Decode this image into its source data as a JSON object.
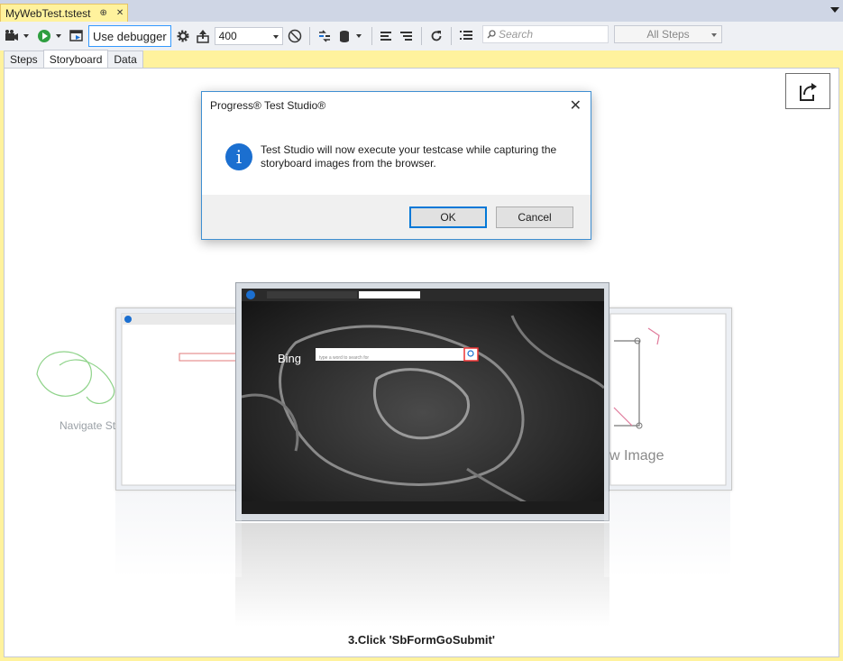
{
  "doc_tab": {
    "title": "MyWebTest.tstest",
    "pin_glyph": "⊕",
    "close_glyph": "✕"
  },
  "toolbar": {
    "use_debugger_label": "Use debugger",
    "speed_value": "400",
    "search_placeholder": "Search",
    "steps_filter_value": "All Steps"
  },
  "subtabs": [
    "Steps",
    "Storyboard",
    "Data"
  ],
  "active_subtab": "Storyboard",
  "storyboard": {
    "left_card_label": "Navigate Step",
    "right_card_label": "w Image",
    "caption": "3.Click 'SbFormGoSubmit'",
    "bing_text": "Bing",
    "bing_search_placeholder": "type a word to search for"
  },
  "dialog": {
    "title": "Progress® Test Studio®",
    "message": "Test Studio will now execute your testcase while capturing the storyboard images from the browser.",
    "ok_label": "OK",
    "cancel_label": "Cancel"
  },
  "colors": {
    "tab_yellow": "#fff29d",
    "accent_blue": "#0078d7",
    "info_blue": "#1b6fd0"
  }
}
